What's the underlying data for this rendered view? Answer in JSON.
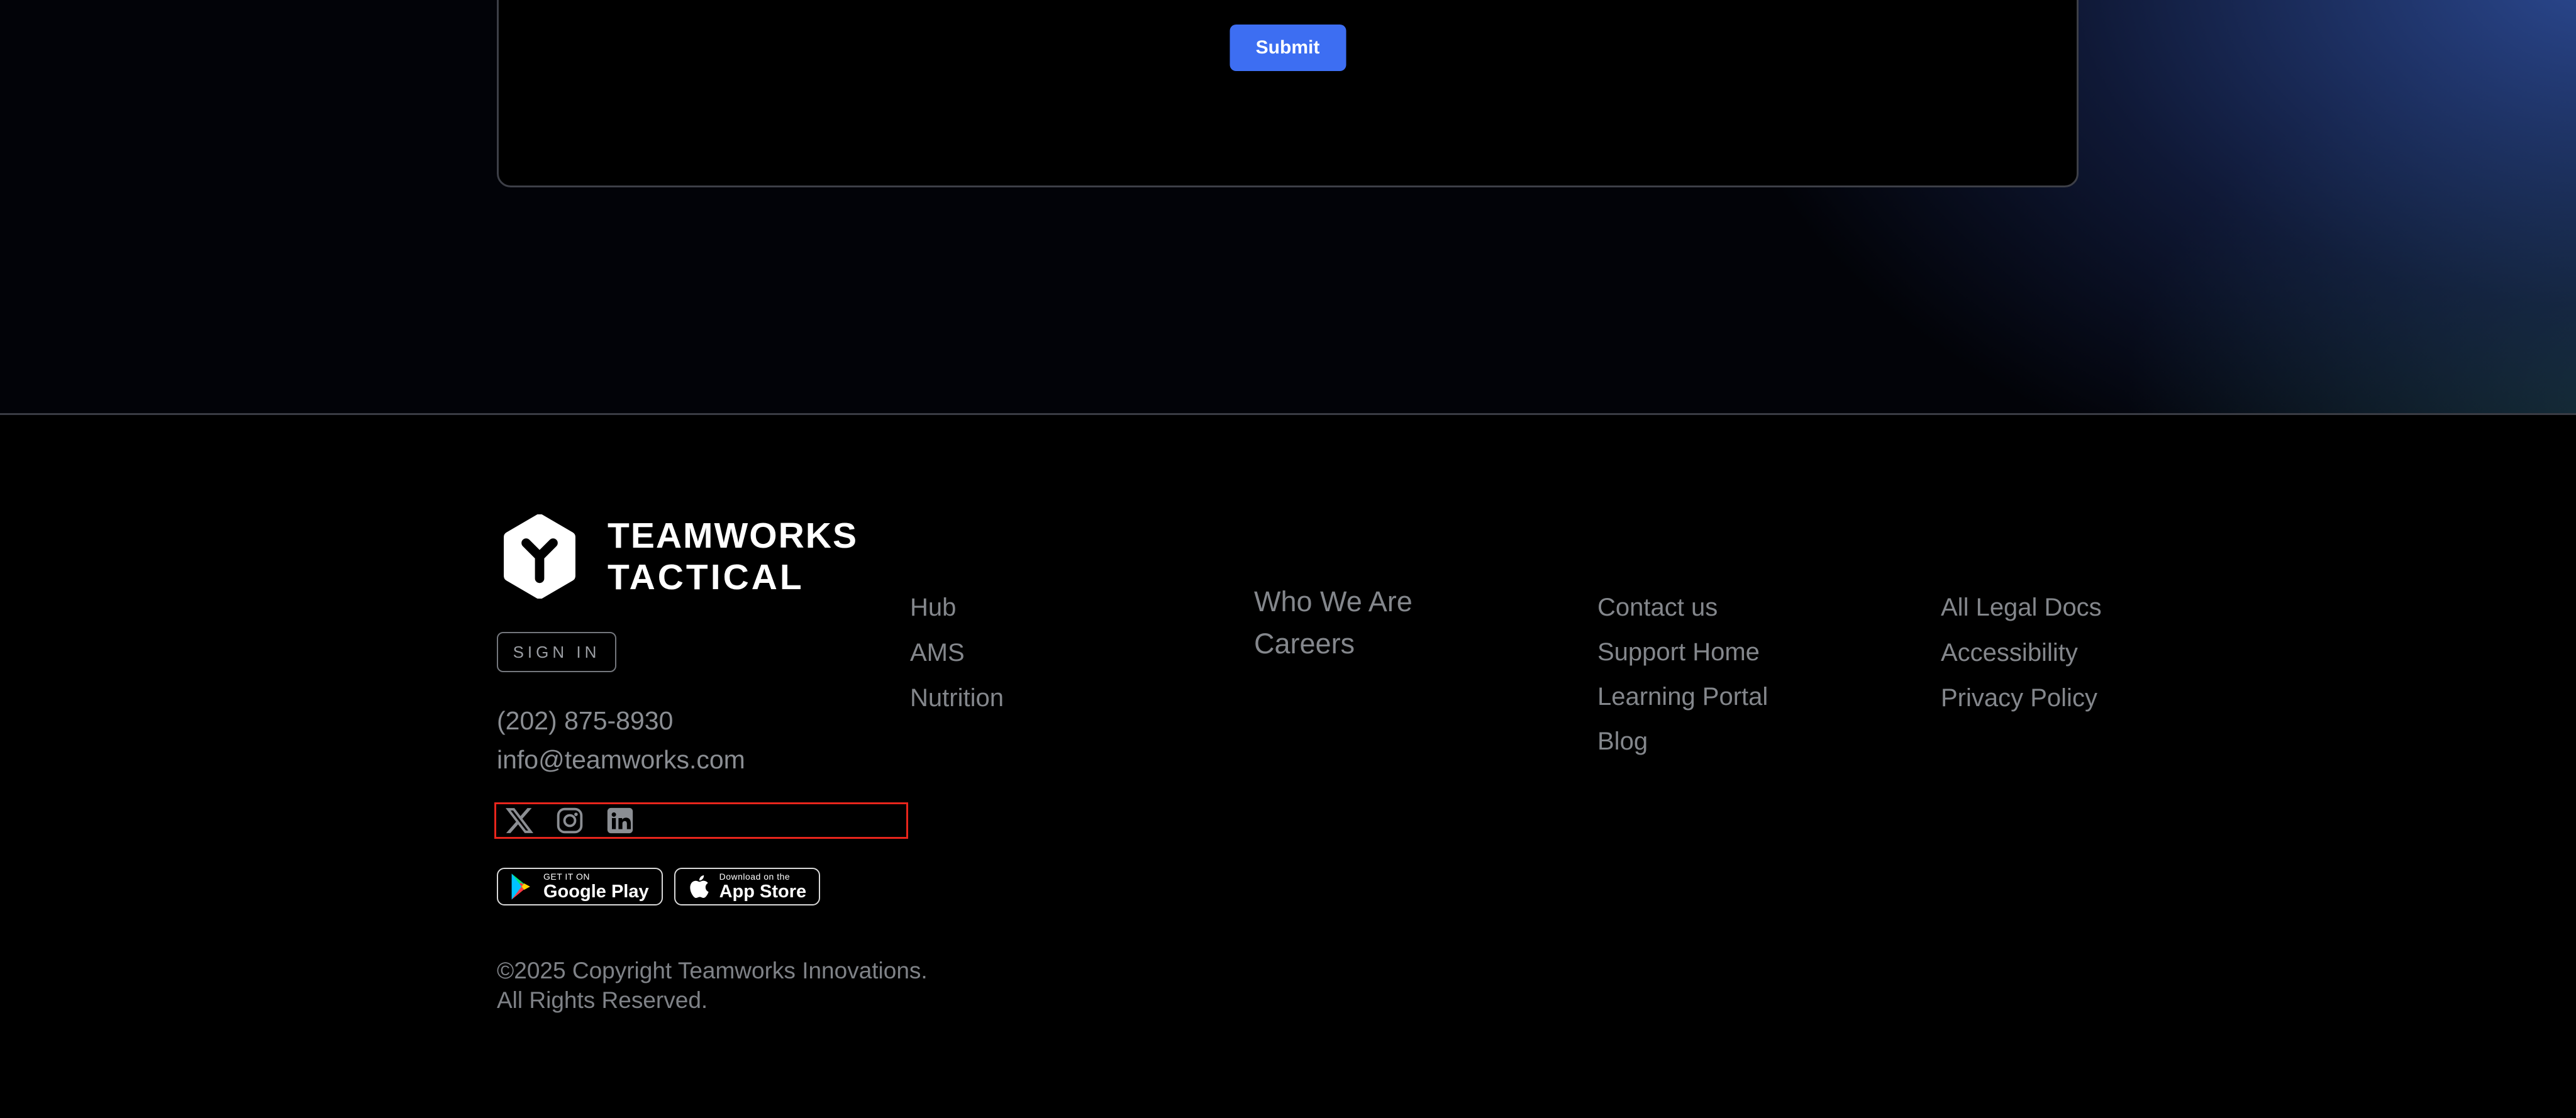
{
  "hero": {
    "submit_label": "Submit"
  },
  "brand": {
    "logo_icon": "teamworks-hex-logo",
    "name_line1": "TEAMWORKS",
    "name_line2": "TACTICAL"
  },
  "account": {
    "sign_in_label": "SIGN IN"
  },
  "contact": {
    "phone": "(202) 875-8930",
    "email": "info@teamworks.com"
  },
  "social": {
    "icons": [
      "x-icon",
      "instagram-icon",
      "linkedin-icon"
    ],
    "highlight_color": "#e8251c"
  },
  "store_badges": {
    "google_play": {
      "tagline": "GET IT ON",
      "store": "Google Play"
    },
    "app_store": {
      "tagline": "Download on the",
      "store": "App Store"
    }
  },
  "copyright": {
    "line1": "©2025 Copyright Teamworks Innovations.",
    "line2": "All Rights Reserved."
  },
  "nav": {
    "columns": [
      {
        "name": "products",
        "items": [
          "Hub",
          "AMS",
          "Nutrition"
        ]
      },
      {
        "name": "company",
        "items": [
          "Who We Are",
          "Careers"
        ]
      },
      {
        "name": "support",
        "items": [
          "Contact us",
          "Support Home",
          "Learning Portal",
          "Blog"
        ]
      },
      {
        "name": "legal",
        "items": [
          "All Legal Docs",
          "Accessibility",
          "Privacy Policy"
        ]
      }
    ]
  },
  "colors": {
    "accent_blue": "#3d6ef2",
    "muted_text": "#8b8e93",
    "card_border": "#3d3f47",
    "highlight_red": "#e8251c"
  }
}
